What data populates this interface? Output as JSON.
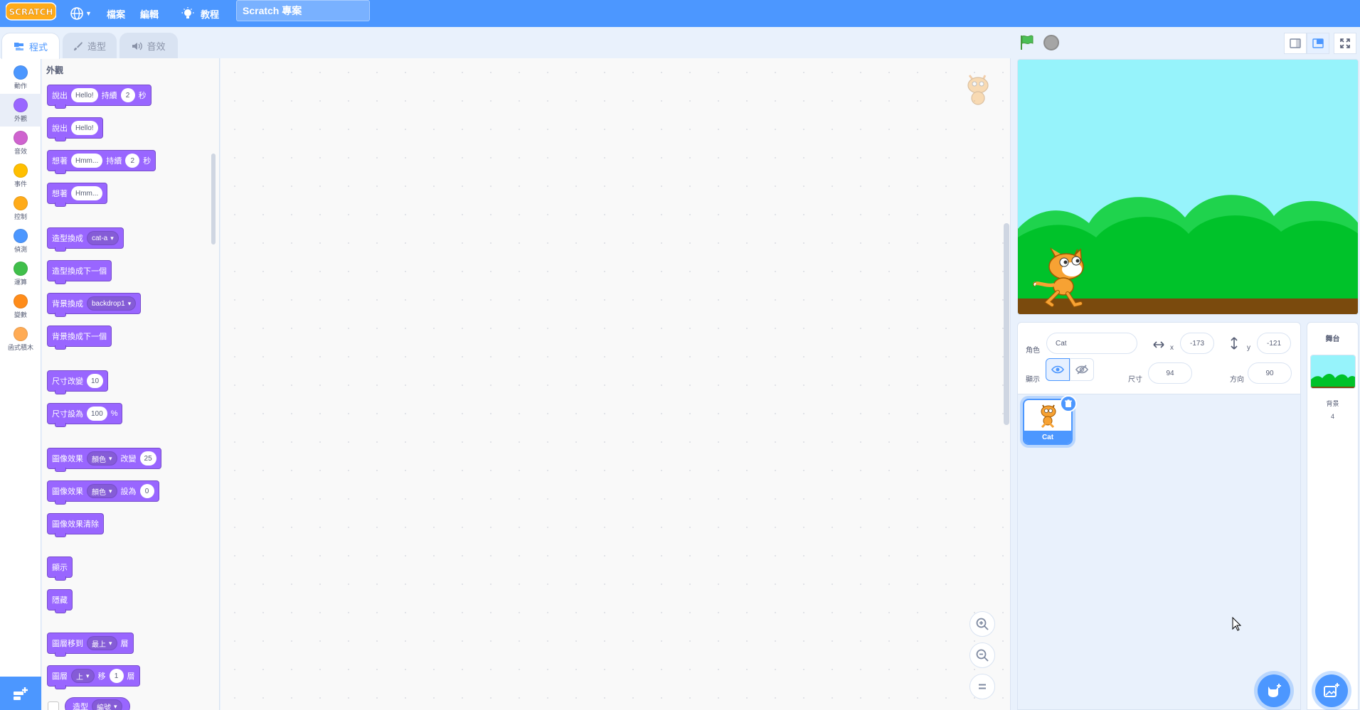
{
  "menubar": {
    "logo_text": "SCRATCH",
    "file_label": "檔案",
    "edit_label": "編輯",
    "tutorials_label": "教程",
    "project_title": "Scratch 專案"
  },
  "tabs": {
    "code": "程式",
    "costumes": "造型",
    "sounds": "音效"
  },
  "categories": [
    {
      "label": "動作",
      "color": "#4c97ff"
    },
    {
      "label": "外觀",
      "color": "#9966ff"
    },
    {
      "label": "音效",
      "color": "#cf63cf"
    },
    {
      "label": "事件",
      "color": "#ffbf00"
    },
    {
      "label": "控制",
      "color": "#ffab19"
    },
    {
      "label": "偵測",
      "color": "#4c97ff"
    },
    {
      "label": "運算",
      "color": "#40bf4a"
    },
    {
      "label": "變數",
      "color": "#ff8c1a"
    },
    {
      "label": "函式積木",
      "color": "#ffab54"
    }
  ],
  "palette": {
    "title": "外觀",
    "say_for": {
      "say": "說出",
      "value": "Hello!",
      "for": "持續",
      "secs": "2",
      "unit": "秒"
    },
    "say": {
      "say": "說出",
      "value": "Hello!"
    },
    "think_for": {
      "think": "想著",
      "value": "Hmm...",
      "for": "持續",
      "secs": "2",
      "unit": "秒"
    },
    "think": {
      "think": "想著",
      "value": "Hmm..."
    },
    "switch_costume": {
      "label": "造型換成",
      "value": "cat-a"
    },
    "next_costume": {
      "label": "造型換成下一個"
    },
    "switch_backdrop": {
      "label": "背景換成",
      "value": "backdrop1"
    },
    "next_backdrop": {
      "label": "背景換成下一個"
    },
    "change_size": {
      "label": "尺寸改變",
      "value": "10"
    },
    "set_size": {
      "label": "尺寸設為",
      "value": "100",
      "unit": "%"
    },
    "change_effect": {
      "label": "圖像效果",
      "effect": "顏色",
      "by": "改變",
      "value": "25"
    },
    "set_effect": {
      "label": "圖像效果",
      "effect": "顏色",
      "to": "設為",
      "value": "0"
    },
    "clear_effects": {
      "label": "圖像效果清除"
    },
    "show": {
      "label": "顯示"
    },
    "hide": {
      "label": "隱藏"
    },
    "go_to_layer": {
      "label": "圖層移到",
      "value": "最上",
      "suffix": "層"
    },
    "go_layers": {
      "label": "圖層",
      "direction": "上",
      "move": "移",
      "value": "1",
      "suffix": "層"
    },
    "costume_reporter": {
      "label": "造型",
      "value": "編號"
    }
  },
  "sprite_info": {
    "sprite_label": "角色",
    "sprite_name": "Cat",
    "x_label": "x",
    "x_value": "-173",
    "y_label": "y",
    "y_value": "-121",
    "show_label": "顯示",
    "size_label": "尺寸",
    "size_value": "94",
    "direction_label": "方向",
    "direction_value": "90"
  },
  "sprites": [
    {
      "name": "Cat"
    }
  ],
  "stage_pane": {
    "title": "舞台",
    "backdrops_label": "背景",
    "backdrops_count": "4"
  },
  "colors": {
    "menubar": "#4c97ff",
    "looks": "#9966ff",
    "accent": "#4c97ff"
  }
}
